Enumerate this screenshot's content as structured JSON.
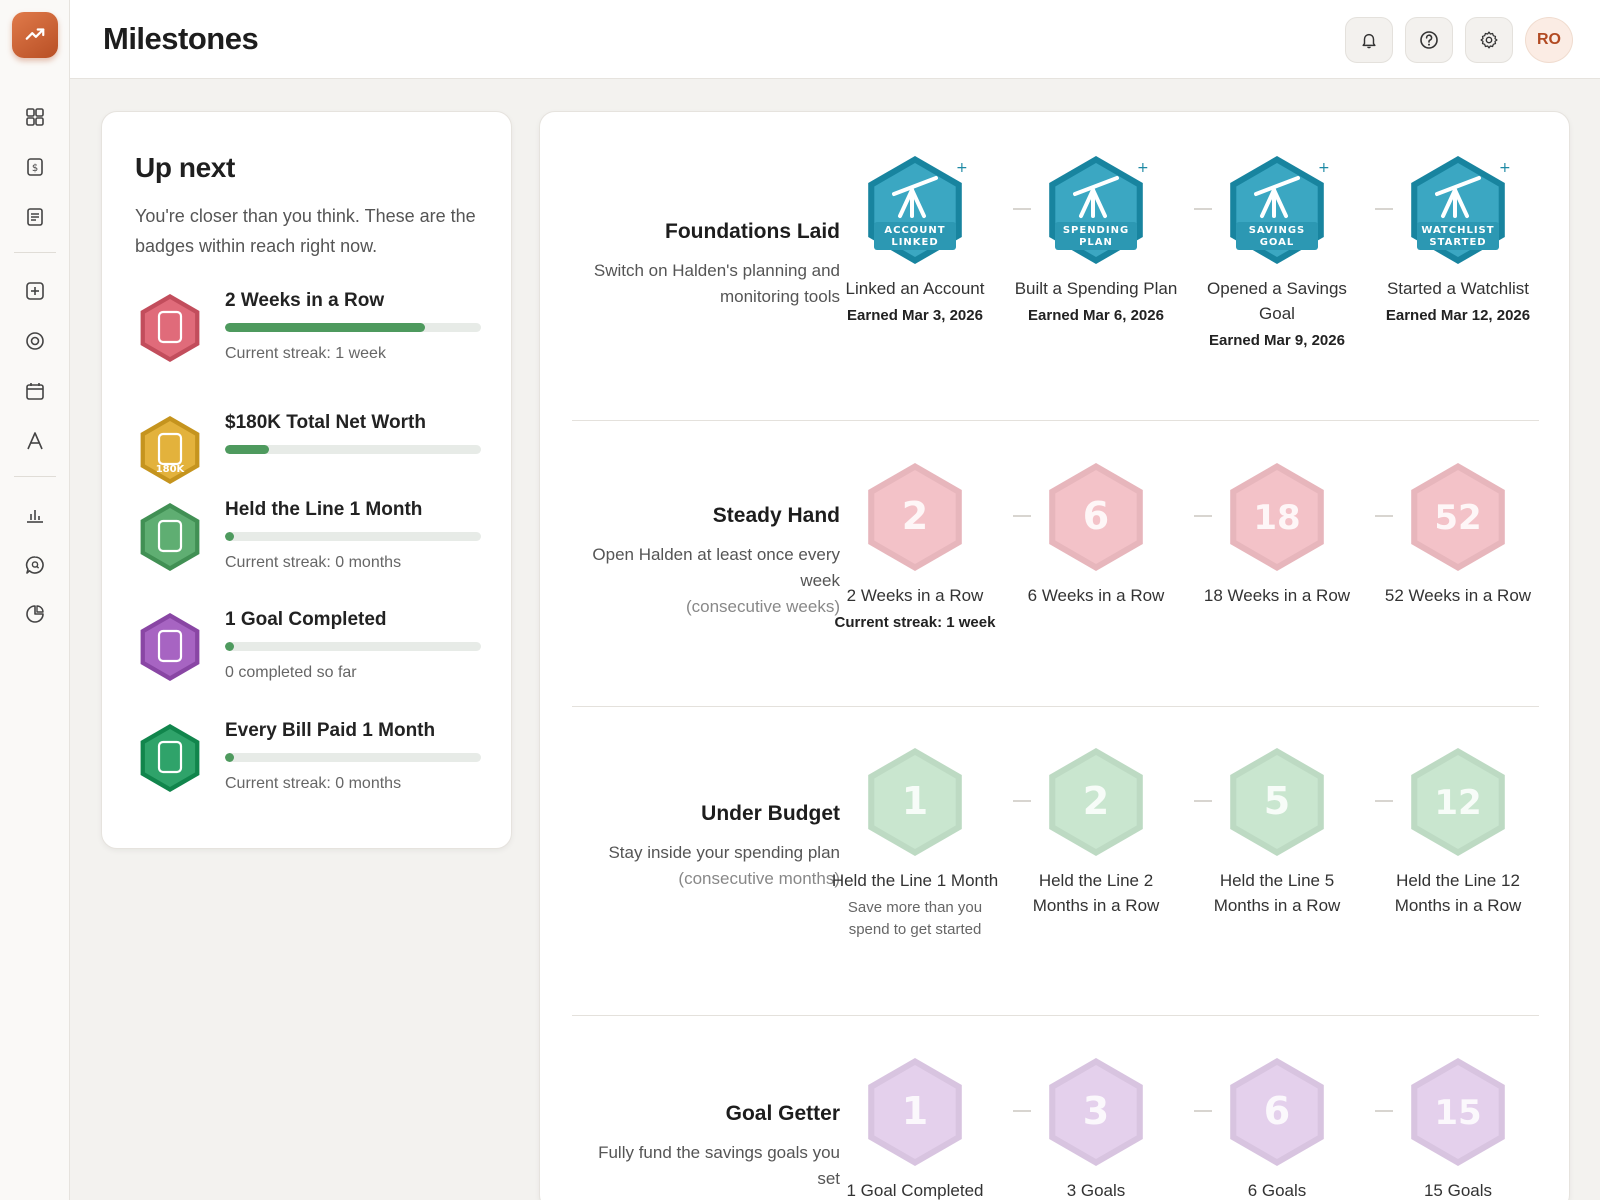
{
  "header": {
    "title": "Milestones",
    "avatar": "RO"
  },
  "sidebar": {
    "icons": [
      "dashboard-icon",
      "dollar-icon",
      "document-icon",
      "plus-square-icon",
      "target-icon",
      "calendar-icon",
      "font-icon",
      "bar-chart-icon",
      "search-chat-icon",
      "pie-chart-icon"
    ]
  },
  "upnext": {
    "title": "Up next",
    "subtitle": "You're closer than you think. These are the badges within reach right now.",
    "items": [
      {
        "title": "2 Weeks in a Row",
        "progress": 0.78,
        "status": "Current streak: 1 week",
        "color": "#e06b7a"
      },
      {
        "title": "$180K Total Net Worth",
        "progress": 0.17,
        "status": "",
        "color": "#e3b23c",
        "hex_label": "180K"
      },
      {
        "title": "Held the Line 1 Month",
        "progress": 0.02,
        "status": "Current streak: 0 months",
        "color": "#5fae72"
      },
      {
        "title": "1 Goal Completed",
        "progress": 0.02,
        "status": "0 completed so far",
        "color": "#a764c2"
      },
      {
        "title": "Every Bill Paid 1 Month",
        "progress": 0.02,
        "status": "Current streak: 0 months",
        "color": "#2fa36a"
      }
    ]
  },
  "sections": [
    {
      "title": "Foundations Laid",
      "desc": "Switch on Halden's planning and monitoring tools",
      "desc_muted": "",
      "color": "#3ba7c2",
      "earned": true,
      "badges": [
        {
          "hex_line1": "ACCOUNT",
          "hex_line2": "LINKED",
          "name": "Linked an Account",
          "sub": "Earned Mar 3, 2026"
        },
        {
          "hex_line1": "SPENDING",
          "hex_line2": "PLAN",
          "name": "Built a Spending Plan",
          "sub": "Earned Mar 6, 2026"
        },
        {
          "hex_line1": "SAVINGS",
          "hex_line2": "GOAL",
          "name": "Opened a Savings Goal",
          "sub": "Earned Mar 9, 2026"
        },
        {
          "hex_line1": "WATCHLIST",
          "hex_line2": "STARTED",
          "name": "Started a Watchlist",
          "sub": "Earned Mar 12, 2026"
        }
      ]
    },
    {
      "title": "Steady Hand",
      "desc": "Open Halden at least once every week",
      "desc_muted": "(consecutive weeks)",
      "color": "#f3c2c8",
      "earned": false,
      "badges": [
        {
          "num": "2",
          "name": "2 Weeks in a Row",
          "sub": "Current streak: 1 week"
        },
        {
          "num": "6",
          "name": "6 Weeks in a Row",
          "sub": ""
        },
        {
          "num": "18",
          "name": "18 Weeks in a Row",
          "sub": ""
        },
        {
          "num": "52",
          "name": "52 Weeks in a Row",
          "sub": ""
        }
      ]
    },
    {
      "title": "Under Budget",
      "desc": "Stay inside your spending plan",
      "desc_muted": "(consecutive months)",
      "color": "#c9e6cf",
      "earned": false,
      "badges": [
        {
          "num": "1",
          "name": "Held the Line 1 Month",
          "sub": "Save more than you spend to get started",
          "sub_light": true
        },
        {
          "num": "2",
          "name": "Held the Line 2 Months in a Row",
          "sub": ""
        },
        {
          "num": "5",
          "name": "Held the Line 5 Months in a Row",
          "sub": ""
        },
        {
          "num": "12",
          "name": "Held the Line 12 Months in a Row",
          "sub": ""
        }
      ]
    },
    {
      "title": "Goal Getter",
      "desc": "Fully fund the savings goals you set",
      "desc_muted": "",
      "color": "#e4d0ec",
      "earned": false,
      "badges": [
        {
          "num": "1",
          "name": "1 Goal Completed",
          "sub": ""
        },
        {
          "num": "3",
          "name": "3 Goals",
          "sub": ""
        },
        {
          "num": "6",
          "name": "6 Goals",
          "sub": ""
        },
        {
          "num": "15",
          "name": "15 Goals",
          "sub": ""
        }
      ]
    }
  ]
}
